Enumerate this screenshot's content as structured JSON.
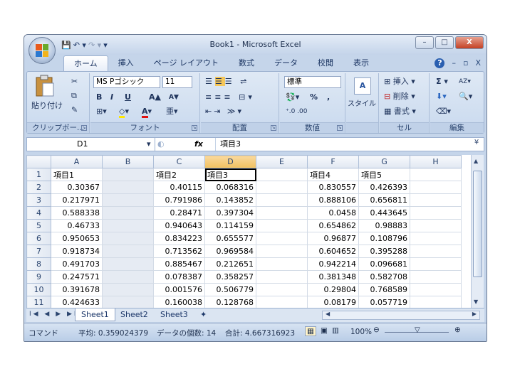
{
  "window": {
    "title": "Book1 - Microsoft Excel",
    "min": "–",
    "max": "□",
    "close": "X"
  },
  "qat": {
    "save": "💾",
    "undo": "↶ ▾",
    "redo": "↷ ▾",
    "custom": "▾"
  },
  "tabs": [
    "ホーム",
    "挿入",
    "ページ レイアウト",
    "数式",
    "データ",
    "校閲",
    "表示"
  ],
  "tab_right": {
    "help": "?",
    "min": "–",
    "restore": "▫",
    "close": "X"
  },
  "ribbon": {
    "clipboard": {
      "paste": "貼り付け",
      "label": "クリップボー..."
    },
    "font": {
      "name": "MS Pゴシック",
      "size": "11",
      "bold": "B",
      "italic": "I",
      "underline": "U",
      "grow": "A▲",
      "shrink": "A▼",
      "label": "フォント"
    },
    "alignment": {
      "label": "配置"
    },
    "number": {
      "format": "標準",
      "percent": "%",
      "comma": ",",
      "label": "数値"
    },
    "styles": {
      "style": "スタイル",
      "label": ""
    },
    "cells": {
      "insert": "挿入",
      "delete": "削除",
      "format": "書式",
      "label": "セル"
    },
    "editing": {
      "sum": "Σ",
      "sort": "AZ",
      "find": "A",
      "label": "編集"
    }
  },
  "formula_bar": {
    "namebox": "D1",
    "fx": "fx",
    "content": "項目3"
  },
  "columns": [
    "A",
    "B",
    "C",
    "D",
    "E",
    "F",
    "G",
    "H"
  ],
  "rows": [
    {
      "n": "1",
      "A": "項目1",
      "B": "",
      "C": "項目2",
      "D": "項目3",
      "E": "",
      "F": "項目4",
      "G": "項目5",
      "H": ""
    },
    {
      "n": "2",
      "A": "0.30367",
      "B": "",
      "C": "0.40115",
      "D": "0.068316",
      "E": "",
      "F": "0.830557",
      "G": "0.426393",
      "H": ""
    },
    {
      "n": "3",
      "A": "0.217971",
      "B": "",
      "C": "0.791986",
      "D": "0.143852",
      "E": "",
      "F": "0.888106",
      "G": "0.656811",
      "H": ""
    },
    {
      "n": "4",
      "A": "0.588338",
      "B": "",
      "C": "0.28471",
      "D": "0.397304",
      "E": "",
      "F": "0.0458",
      "G": "0.443645",
      "H": ""
    },
    {
      "n": "5",
      "A": "0.46733",
      "B": "",
      "C": "0.940643",
      "D": "0.114159",
      "E": "",
      "F": "0.654862",
      "G": "0.98883",
      "H": ""
    },
    {
      "n": "6",
      "A": "0.950653",
      "B": "",
      "C": "0.834223",
      "D": "0.655577",
      "E": "",
      "F": "0.96877",
      "G": "0.108796",
      "H": ""
    },
    {
      "n": "7",
      "A": "0.918734",
      "B": "",
      "C": "0.713562",
      "D": "0.969584",
      "E": "",
      "F": "0.604652",
      "G": "0.395288",
      "H": ""
    },
    {
      "n": "8",
      "A": "0.491703",
      "B": "",
      "C": "0.885467",
      "D": "0.212651",
      "E": "",
      "F": "0.942214",
      "G": "0.096681",
      "H": ""
    },
    {
      "n": "9",
      "A": "0.247571",
      "B": "",
      "C": "0.078387",
      "D": "0.358257",
      "E": "",
      "F": "0.381348",
      "G": "0.582708",
      "H": ""
    },
    {
      "n": "10",
      "A": "0.391678",
      "B": "",
      "C": "0.001576",
      "D": "0.506779",
      "E": "",
      "F": "0.29804",
      "G": "0.768589",
      "H": ""
    },
    {
      "n": "11",
      "A": "0.424633",
      "B": "",
      "C": "0.160038",
      "D": "0.128768",
      "E": "",
      "F": "0.08179",
      "G": "0.057719",
      "H": ""
    }
  ],
  "sheets": [
    "Sheet1",
    "Sheet2",
    "Sheet3"
  ],
  "sheet_nav": "I◀ ◀ ▶ ▶I",
  "status": {
    "mode": "コマンド",
    "average": "平均: 0.359024379",
    "count": "データの個数: 14",
    "sum": "合計: 4.667316923",
    "zoom": "100%"
  }
}
